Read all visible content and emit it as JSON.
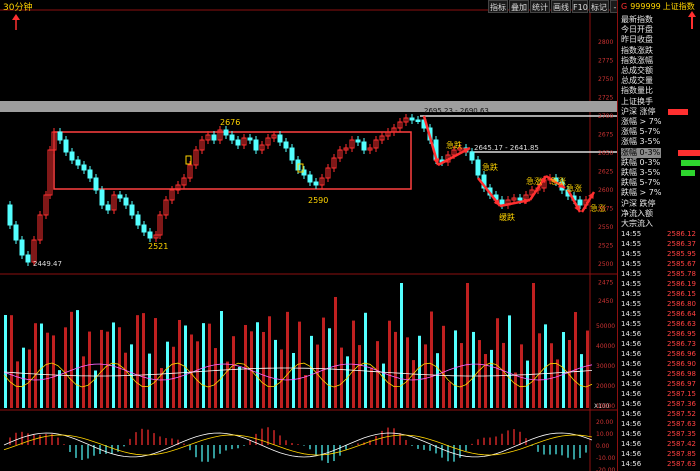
{
  "window": {
    "period_label": "30分钟"
  },
  "toolbar": {
    "buttons": [
      "指标",
      "叠加",
      "统计",
      "画线",
      "F10",
      "标记",
      "-",
      "+",
      "返回"
    ]
  },
  "chart": {
    "price_axis": [
      "2800",
      "2775",
      "2750",
      "2725",
      "2700",
      "2675",
      "2650",
      "2625",
      "2600",
      "2575",
      "2550",
      "2525",
      "2500",
      "2475",
      "2450"
    ],
    "annotations": {
      "low_1": "2449.47",
      "label_2676": "2676",
      "label_2521": "2521",
      "label_2590": "2590",
      "top_range": "2695.23 - 2690.63",
      "mid_range": "2645.17 - 2641.85",
      "sharp_drop_1": "急跌",
      "sharp_drop_2": "急跌",
      "sharp_rise_1": "急涨",
      "sharp_rise_2": "急涨",
      "slow_drop": "缓跌",
      "sharp_rise_3": "急涨",
      "sharp_rise_4": "急涨"
    },
    "volume_axis": [
      "50000",
      "40000",
      "30000",
      "20000",
      "10000"
    ],
    "volume_unit": "X100",
    "macd_axis": [
      "20.00",
      "10.00",
      "0.00",
      "-10.00",
      "-20.00"
    ]
  },
  "side_panel": {
    "mark": "G",
    "code": "999999",
    "name": "上证指数",
    "stats": [
      "最新指数",
      "今日开盘",
      "昨日收盘",
      "指数涨跌",
      "指数涨幅",
      "总成交额",
      "总成交量",
      "指数量比",
      "上证换手",
      "沪深 涨停",
      "涨幅 > 7%",
      "涨幅 5-7%",
      "涨幅 3-5%",
      "涨幅 0-3%",
      "跌幅 0-3%",
      "跌幅 3-5%",
      "跌幅 5-7%",
      "跌幅 > 7%",
      "沪深 跌停",
      "净流入额",
      "大宗流入"
    ],
    "ticks": [
      {
        "time": "14:55",
        "price": "2586.12"
      },
      {
        "time": "14:55",
        "price": "2586.37"
      },
      {
        "time": "14:55",
        "price": "2585.95"
      },
      {
        "time": "14:55",
        "price": "2585.67"
      },
      {
        "time": "14:55",
        "price": "2585.78"
      },
      {
        "time": "14:55",
        "price": "2586.19"
      },
      {
        "time": "14:55",
        "price": "2586.15"
      },
      {
        "time": "14:55",
        "price": "2586.80"
      },
      {
        "time": "14:55",
        "price": "2586.64"
      },
      {
        "time": "14:55",
        "price": "2586.63"
      },
      {
        "time": "14:56",
        "price": "2586.95"
      },
      {
        "time": "14:56",
        "price": "2586.73"
      },
      {
        "time": "14:56",
        "price": "2586.96"
      },
      {
        "time": "14:56",
        "price": "2586.90"
      },
      {
        "time": "14:56",
        "price": "2586.98"
      },
      {
        "time": "14:56",
        "price": "2586.97"
      },
      {
        "time": "14:56",
        "price": "2587.15"
      },
      {
        "time": "14:56",
        "price": "2587.36"
      },
      {
        "time": "14:56",
        "price": "2587.52"
      },
      {
        "time": "14:56",
        "price": "2587.63"
      },
      {
        "time": "14:56",
        "price": "2587.35"
      },
      {
        "time": "14:56",
        "price": "2587.42"
      },
      {
        "time": "14:56",
        "price": "2587.85"
      },
      {
        "time": "14:56",
        "price": "2587.63"
      }
    ]
  },
  "colors": {
    "up": "#ff3030",
    "down": "#54ffff",
    "grid": "#7a0000",
    "note": "#ffd400"
  }
}
